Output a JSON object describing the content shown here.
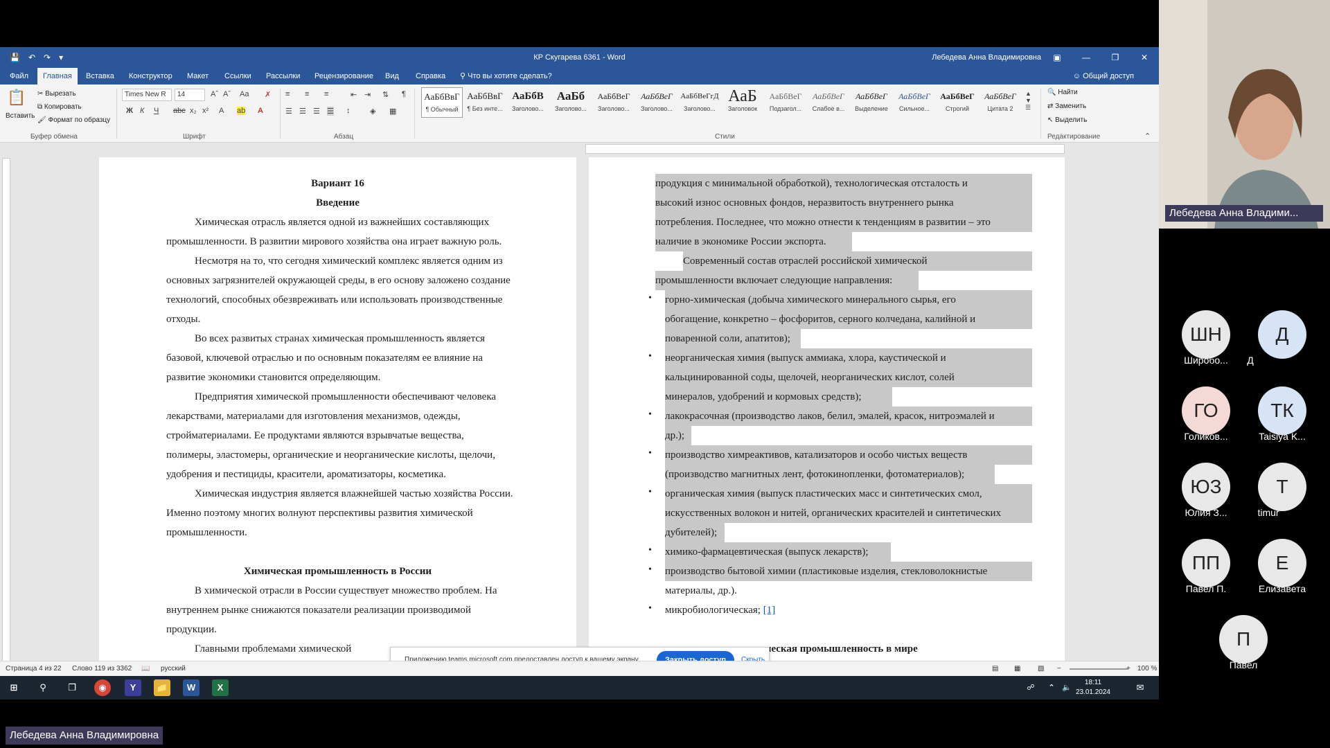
{
  "window": {
    "title": "КР Скугарева 6361 - Word",
    "user": "Лебедева Анна Владимировна"
  },
  "tabs": [
    "Файл",
    "Главная",
    "Вставка",
    "Конструктор",
    "Макет",
    "Ссылки",
    "Рассылки",
    "Рецензирование",
    "Вид",
    "Справка"
  ],
  "tell_me": "Что вы хотите сделать?",
  "share_label": "Общий доступ",
  "ribbon": {
    "clipboard": {
      "paste": "Вставить",
      "cut": "Вырезать",
      "copy": "Копировать",
      "format_painter": "Формат по образцу",
      "group": "Буфер обмена"
    },
    "font": {
      "name": "Times New R",
      "size": "14",
      "group": "Шрифт"
    },
    "paragraph_group": "Абзац",
    "styles": [
      {
        "sample": "АаБбВвГ",
        "name": "¶ Обычный"
      },
      {
        "sample": "АаБбВвГ",
        "name": "¶ Без инте..."
      },
      {
        "sample": "АаБбВ",
        "name": "Заголово..."
      },
      {
        "sample": "АаБб",
        "name": "Заголово..."
      },
      {
        "sample": "АаБбВеГ",
        "name": "Заголово..."
      },
      {
        "sample": "АаБбВеГ",
        "name": "Заголово..."
      },
      {
        "sample": "АаБбВеГгД",
        "name": "Заголово..."
      },
      {
        "sample": "АаБ",
        "name": "Заголовок"
      },
      {
        "sample": "АаБбВеГ",
        "name": "Подзагол..."
      },
      {
        "sample": "АаБбВеГ",
        "name": "Слабое в..."
      },
      {
        "sample": "АаБбВеГ",
        "name": "Выделение"
      },
      {
        "sample": "АаБбВеГ",
        "name": "Сильное..."
      },
      {
        "sample": "АаБбВеГ",
        "name": "Строгий"
      },
      {
        "sample": "АаБбВеГ",
        "name": "Цитата 2"
      }
    ],
    "styles_group": "Стили",
    "editing": {
      "find": "Найти",
      "replace": "Заменить",
      "select": "Выделить",
      "group": "Редактирование"
    }
  },
  "page1": {
    "variant": "Вариант 16",
    "intro_title": "Введение",
    "lines": [
      "Химическая отрасль является одной из важнейших составляющих",
      "промышленности. В развитии мирового хозяйства она играет важную роль.",
      "Несмотря на то, что сегодня химический комплекс является одним из",
      "основных загрязнителей окружающей среды, в его основу заложено создание",
      "технологий, способных обезвреживать или использовать производственные",
      "отходы.",
      "Во всех развитых странах химическая промышленность является",
      "базовой, ключевой отраслью и по основным показателям ее влияние на",
      "развитие экономики становится определяющим.",
      "Предприятия химической промышленности обеспечивают человека",
      "лекарствами, материалами для изготовления механизмов, одежды,",
      "стройматериалами. Ее продуктами являются взрывчатые вещества,",
      "полимеры, эластомеры, органические и неорганические кислоты, щелочи,",
      "удобрения и пестициды, красители, ароматизаторы, косметика.",
      "Химическая индустрия является влажнейшей частью хозяйства России.",
      "Именно поэтому многих волнуют перспективы развития химической",
      "промышленности."
    ],
    "section_title": "Химическая промышленность в России",
    "lines2": [
      "В химической отрасли в России существует множество проблем. На",
      "внутреннем рынке снижаются показатели реализации производимой",
      "продукции.",
      "Главными проблемами химической"
    ]
  },
  "page2": {
    "lines": [
      "продукция с минимальной обработкой), технологическая отсталость и",
      "высокий износ основных фондов, неразвитость внутреннего рынка",
      "потребления. Последнее, что можно отнести к тенденциям в развитии – это",
      "наличие в экономике России экспорта.",
      "Современный состав отраслей российской химической",
      "промышленности включает следующие направления:"
    ],
    "bullets": [
      [
        "горно-химическая (добыча химического минерального сырья, его",
        "обогащение, конкретно – фосфоритов, серного колчедана, калийной и",
        "поваренной соли, апатитов);"
      ],
      [
        "неорганическая химия (выпуск аммиака, хлора, каустической и",
        "кальцинированной соды, щелочей, неорганических кислот, солей",
        "минералов, удобрений и кормовых средств);"
      ],
      [
        "лакокрасочная (производство лаков, белил, эмалей, красок, нитроэмалей и",
        "др.);"
      ],
      [
        "производство химреактивов, катализаторов и особо чистых веществ",
        "(производство магнитных лент, фотокинопленки, фотоматериалов);"
      ],
      [
        "органическая химия (выпуск пластических масс и синтетических смол,",
        "искусственных волокон и нитей, органических красителей и синтетических",
        "дубителей);"
      ],
      [
        "химико-фармацевтическая (выпуск лекарств);"
      ],
      [
        "производство бытовой химии (пластиковые изделия, стекловолокнистые",
        "материалы, др.)."
      ],
      [
        "микробиологическая;"
      ]
    ],
    "footnote": "[1]",
    "next_heading": "ческая промышленность в мире"
  },
  "statusbar": {
    "page": "Страница 4 из 22",
    "words": "Слово 119 из 3362",
    "language": "русский",
    "zoom": "100 %"
  },
  "notification": {
    "message": "Приложению teams.microsoft.com предоставлен доступ к вашему экрану.",
    "stop_button": "Закрыть доступ",
    "hide_link": "Скрыть"
  },
  "taskbar": {
    "time": "18:11",
    "date": "23.01.2024"
  },
  "participants": {
    "camera_name": "Лебедева Анна Владими...",
    "presenter": "Лебедева Анна Владимировна",
    "people": [
      {
        "initials": "ШН",
        "name": "Широбо...",
        "color": "#e8e8e8"
      },
      {
        "initials": "Д",
        "name": "Д",
        "color": "#d6e4f5"
      },
      {
        "initials": "ГО",
        "name": "Голиков...",
        "color": "#f5d9d6"
      },
      {
        "initials": "ТК",
        "name": "Taisiya K...",
        "color": "#d6e4f5"
      },
      {
        "initials": "ЮЗ",
        "name": "Юлия З...",
        "color": "#e8e8e8"
      },
      {
        "initials": "Т",
        "name": "timur",
        "color": "#e8e8e8"
      },
      {
        "initials": "ПП",
        "name": "Павел П.",
        "color": "#e8e8e8"
      },
      {
        "initials": "Е",
        "name": "Елизавета",
        "color": "#e8e8e8"
      },
      {
        "initials": "П",
        "name": "Павел",
        "color": "#e8e8e8"
      }
    ]
  }
}
